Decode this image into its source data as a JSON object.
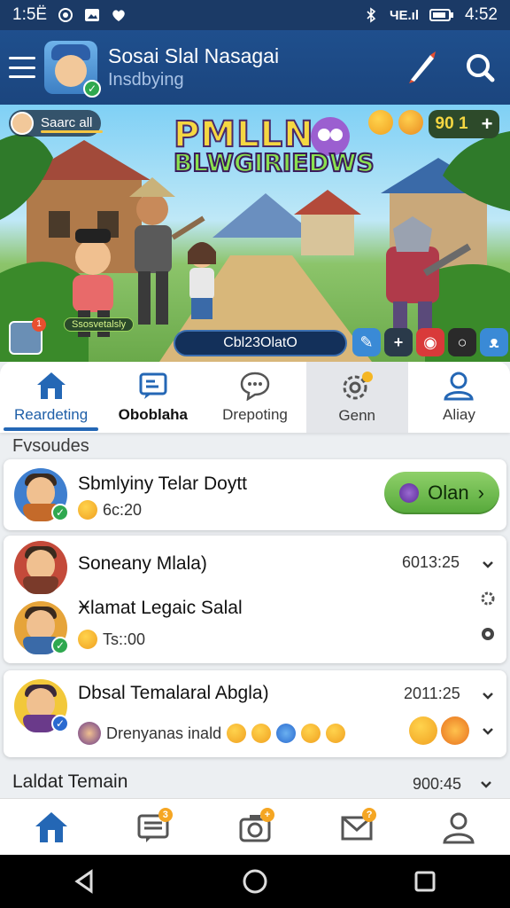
{
  "status_bar": {
    "time_left": "1:5Ё",
    "time_right": "4:52",
    "signal_text": "ЧЕ.ıl"
  },
  "header": {
    "title": "Sosai Slal Nasagai",
    "subtitle": "Insdbying",
    "icons": [
      "menu-icon",
      "pen-icon",
      "search-icon"
    ]
  },
  "hero": {
    "chip_label": "Saarc all",
    "title_line1": "PMLLN",
    "title_line2": "BLWGIRIEDWS",
    "speech_text": "Ssosvetalsly",
    "score_text": "90 1",
    "code_text": "Cbl23OlatO"
  },
  "tabs": [
    {
      "label": "Reardeting",
      "icon": "home-icon",
      "state": "active"
    },
    {
      "label": "Oboblaha",
      "icon": "chat-board-icon",
      "state": "bold"
    },
    {
      "label": "Drepoting",
      "icon": "message-bubble-icon",
      "state": "normal"
    },
    {
      "label": "Genn",
      "icon": "gear-icon",
      "state": "selected"
    },
    {
      "label": "Aliay",
      "icon": "user-icon",
      "state": "normal"
    }
  ],
  "sections": {
    "favorites": "Fvsoudes",
    "latest": "Laldat Temain"
  },
  "cards": [
    {
      "name": "Sbmlyiny Telar Doytt",
      "sub": "6c:20",
      "button_label": "Olan"
    },
    {
      "name": "Soneany Mlala)",
      "time": "6013:25",
      "name2": "Ӿlamat Legaic Salal",
      "sub": "Ts::00"
    },
    {
      "name": "Dbsal Temalaral Abgla)",
      "time": "2011:25",
      "sub": "Drenyanas inald"
    }
  ],
  "latest_time": "900:45",
  "bottom_nav": [
    {
      "icon": "home-icon",
      "badge": ""
    },
    {
      "icon": "chat-board-icon",
      "badge": "3"
    },
    {
      "icon": "camera-icon",
      "badge": "+"
    },
    {
      "icon": "mail-icon",
      "badge": "?"
    },
    {
      "icon": "profile-icon",
      "badge": ""
    }
  ],
  "colors": {
    "brand": "#1f4f8d",
    "accent": "#2467b5",
    "join": "#6cbd4a"
  }
}
